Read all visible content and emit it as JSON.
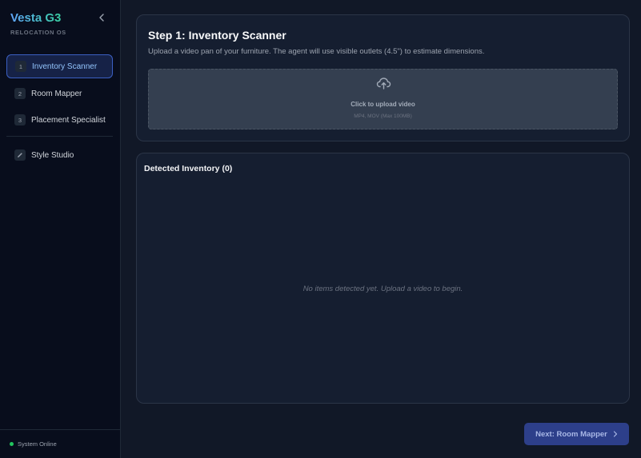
{
  "sidebar": {
    "brand": "Vesta G3",
    "subtitle": "RELOCATION OS",
    "collapse_icon": "chevron-left-icon",
    "items": [
      {
        "number": "1",
        "label": "Inventory Scanner",
        "active": true
      },
      {
        "number": "2",
        "label": "Room Mapper",
        "active": false
      },
      {
        "number": "3",
        "label": "Placement Specialist",
        "active": false
      }
    ],
    "studio": {
      "label": "Style Studio",
      "icon": "pencil-icon"
    },
    "status": "System Online"
  },
  "step": {
    "title": "Step 1: Inventory Scanner",
    "description": "Upload a video pan of your furniture. The agent will use visible outlets (4.5\") to estimate dimensions."
  },
  "upload": {
    "icon": "cloud-upload-icon",
    "label": "Click to upload video",
    "hint": "MP4, MOV (Max 100MB)"
  },
  "inventory": {
    "title": "Detected Inventory (0)",
    "empty": "No items detected yet. Upload a video to begin."
  },
  "footer": {
    "next_label": "Next: Room Mapper"
  },
  "colors": {
    "accent": "#3b5fc2",
    "status_online": "#22c55e",
    "background": "#111827"
  }
}
